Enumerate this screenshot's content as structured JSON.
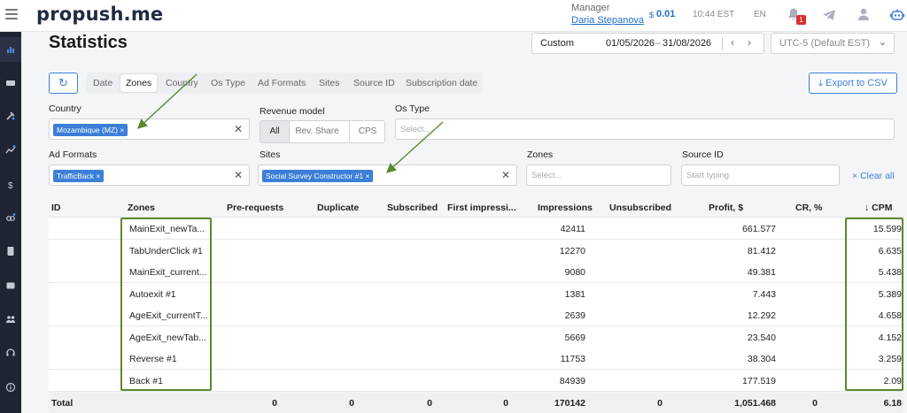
{
  "brand": {
    "logo_text": "propush.me"
  },
  "header": {
    "role": "Manager",
    "user_name": "Daria Stepanova",
    "balance_currency": "$",
    "balance": "0.01",
    "time": "10:44 EST",
    "language": "EN",
    "notifications_count": "1"
  },
  "page": {
    "title": "Statistics"
  },
  "date_range": {
    "type": "Custom",
    "from": "01/05/2026",
    "dash": "–",
    "to": "31/08/2026",
    "prev": "‹",
    "next": "›"
  },
  "timezone": {
    "value": "UTC-5 (Default EST)"
  },
  "group_tabs": [
    {
      "label": "Date"
    },
    {
      "label": "Zones",
      "active": true
    },
    {
      "label": "Country"
    },
    {
      "label": "Os Type"
    },
    {
      "label": "Ad Formats"
    },
    {
      "label": "Sites"
    },
    {
      "label": "Source ID"
    },
    {
      "label": "Subscription date"
    }
  ],
  "export": {
    "label": "Export to CSV"
  },
  "filters": {
    "country": {
      "label": "Country",
      "chip": "Mozambique (MZ)"
    },
    "revenue_model": {
      "label": "Revenue model",
      "options": [
        "All",
        "Rev. Share",
        "CPS"
      ],
      "selected": "All"
    },
    "os_type": {
      "label": "Os Type",
      "placeholder": "Select..."
    },
    "ad_formats": {
      "label": "Ad Formats",
      "chip": "TrafficBack"
    },
    "sites": {
      "label": "Sites",
      "chip": "Social Survey Constructor #1"
    },
    "zones": {
      "label": "Zones",
      "placeholder": "Select..."
    },
    "source_id": {
      "label": "Source ID",
      "placeholder": "Start typing"
    },
    "clear_all": "Clear all"
  },
  "table": {
    "headers": [
      "ID",
      "Zones",
      "Pre-requests",
      "Duplicate",
      "Subscribed",
      "First impressi...",
      "Impressions",
      "Unsubscribed",
      "Profit, $",
      "CR, %",
      "CPM"
    ],
    "sort_indicator": "↓",
    "rows": [
      {
        "zone": "MainExit_newTa...",
        "impressions": "42411",
        "profit": "661.577",
        "cpm": "15.599"
      },
      {
        "zone": "TabUnderClick #1",
        "impressions": "12270",
        "profit": "81.412",
        "cpm": "6.635"
      },
      {
        "zone": "MainExit_current...",
        "impressions": "9080",
        "profit": "49.381",
        "cpm": "5.438"
      },
      {
        "zone": "Autoexit #1",
        "impressions": "1381",
        "profit": "7.443",
        "cpm": "5.389"
      },
      {
        "zone": "AgeExit_currentT...",
        "impressions": "2639",
        "profit": "12.292",
        "cpm": "4.658"
      },
      {
        "zone": "AgeExit_newTab...",
        "impressions": "5669",
        "profit": "23.540",
        "cpm": "4.152"
      },
      {
        "zone": "Reverse #1",
        "impressions": "11753",
        "profit": "38.304",
        "cpm": "3.259"
      },
      {
        "zone": "Back #1",
        "impressions": "84939",
        "profit": "177.519",
        "cpm": "2.09"
      }
    ],
    "total": {
      "label": "Total",
      "pre_requests": "0",
      "duplicate": "0",
      "subscribed": "0",
      "first_impressions": "0",
      "impressions": "170142",
      "unsubscribed": "0",
      "profit": "1,051.468",
      "cr": "0",
      "cpm": "6.18"
    }
  },
  "colors": {
    "accent": "#3b7fd9",
    "sidebar": "#1f2433",
    "highlight": "#5a8a2e",
    "badge": "#d93030"
  }
}
